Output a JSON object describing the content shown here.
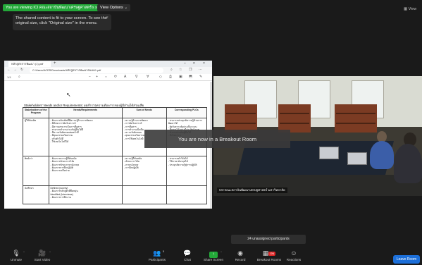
{
  "top_bar": {
    "share_status": "You are viewing ICI คณะสถาบันพัฒนาเศรษฐศาสตร์'s screen",
    "view_options": "View Options ⌄",
    "view_right": "View"
  },
  "tooltip": {
    "text": "The shared content is fit to your screen. To see the original size, click \"Original size\" in the menu."
  },
  "doc_window": {
    "tab_title": "หลักสูตรการพัฒนา (1).pdf",
    "url": "C:/Users/ACER/Downloads/หลักสูตรการพัฒนาตนเอง1.pdf",
    "page_indicator": "1/4",
    "heading": "Stakeholders' Needs and/or Requirements: ผลสำรวจความต้องการของผู้มีส่วนได้ส่วนเสีย",
    "table": {
      "headers": [
        "Stakeholders of the Program",
        "Needs/Requirements",
        "Sum of Needs",
        "Corresponding PLOs"
      ],
      "rows": [
        {
          "stakeholder": "ผู้ใช้บัณฑิต",
          "needs": "- ต้องการบัณฑิตที่มีความรู้ด้านการพัฒนา\n- มีทักษะการคิดวิเคราะห์\n- มีความสามารถในการสื่อสาร\n- สามารถทำงานร่วมกับผู้อื่นได้ดี\n- มีความรับผิดชอบต่อหน้าที่\n- มีคุณธรรมจริยธรรม\n- ปรับตัวได้ดี\n- ใช้เทคโนโลยีได้",
          "sum": "- ความรู้ด้านการพัฒนา\n- การคิดวิเคราะห์\n- การสื่อสาร\n- การทำงานเป็นทีม\n- ความรับผิดชอบ\n- คุณธรรมจริยธรรม\n- การใช้เทคโนโลยี",
          "plos": "- สามารถประยุกต์ความรู้ด้านการพัฒนาได้\n- คิดวิเคราะห์อย่างเป็นระบบ\n- สื่อสารได้อย่างมีประสิทธิภาพ\n- ทำงานร่วมกับผู้อื่นได้\n- มีจริยธรรม"
        },
        {
          "stakeholder": "ศิษย์เก่า",
          "needs": "- ต้องการความรู้ที่ทันสมัย\n- ต้องการทักษะการวิจัย\n- ต้องการทักษะภาษาอังกฤษ\n- ต้องการการฝึกปฏิบัติ\n- ต้องการเครือข่าย",
          "sum": "- ความรู้ที่ทันสมัย\n- ทักษะการวิจัย\n- ภาษาอังกฤษ\n- การฝึกปฏิบัติ",
          "plos": "- สามารถทำวิจัยได้\n- ใช้ภาษาอังกฤษได้\n- ประยุกต์ความรู้สู่การปฏิบัติ"
        },
        {
          "stakeholder": "นักศึกษา",
          "needs": "Defined (survey)\n- ต้องการหลักสูตรที่ยืดหยุ่น\nIdentified (Interviews)\n- ต้องการการฝึกงาน",
          "sum": "",
          "plos": ""
        }
      ]
    }
  },
  "breakout_banner": "You are now in a Breakout Room",
  "video": {
    "participant_label": "CO-คณะสถาบันพัฒนาเศรษฐศาสตร์ มหาวิทยาลัย"
  },
  "unassigned": "24 unassigned participants",
  "toolbar": {
    "unmute": "Unmute",
    "start_video": "Start Video",
    "participants": "Participants",
    "participants_count": "5",
    "chat": "Chat",
    "share_screen": "Share Screen",
    "record": "Record",
    "breakout_rooms": "Breakout Rooms",
    "breakout_badge": "ON",
    "reactions": "Reactions",
    "leave": "Leave Room"
  },
  "colors": {
    "share_green": "#23a839",
    "leave_blue": "#1c6fd9",
    "background": "#1a1a1a"
  }
}
